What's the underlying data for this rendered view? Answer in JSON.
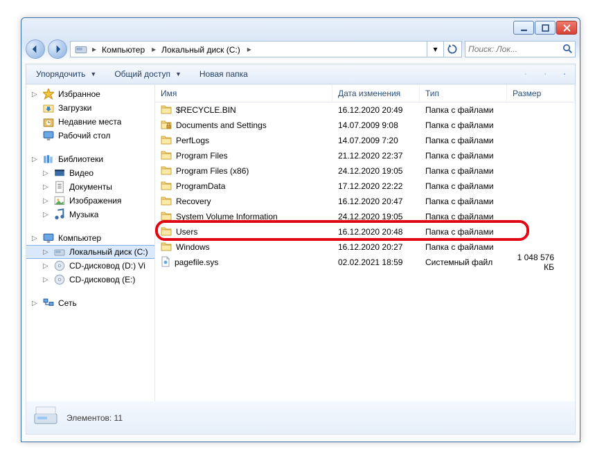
{
  "window": {
    "breadcrumb": {
      "root": "Компьютер",
      "path": "Локальный диск (C:)"
    },
    "search_placeholder": "Поиск: Лок...",
    "toolbar": {
      "organize": "Упорядочить",
      "share": "Общий доступ",
      "newfolder": "Новая папка"
    },
    "sidebar": {
      "favorites": {
        "label": "Избранное",
        "items": [
          "Загрузки",
          "Недавние места",
          "Рабочий стол"
        ]
      },
      "libraries": {
        "label": "Библиотеки",
        "items": [
          "Видео",
          "Документы",
          "Изображения",
          "Музыка"
        ]
      },
      "computer": {
        "label": "Компьютер",
        "items": [
          "Локальный диск (C:)",
          "CD-дисковод (D:) Vi",
          "CD-дисковод (E:)"
        ]
      },
      "network": {
        "label": "Сеть"
      }
    },
    "columns": {
      "name": "Имя",
      "date": "Дата изменения",
      "type": "Тип",
      "size": "Размер"
    },
    "rows": [
      {
        "name": "$RECYCLE.BIN",
        "date": "16.12.2020 20:49",
        "type": "Папка с файлами",
        "size": "",
        "icon": "folder"
      },
      {
        "name": "Documents and Settings",
        "date": "14.07.2009 9:08",
        "type": "Папка с файлами",
        "size": "",
        "icon": "folder-lock"
      },
      {
        "name": "PerfLogs",
        "date": "14.07.2009 7:20",
        "type": "Папка с файлами",
        "size": "",
        "icon": "folder"
      },
      {
        "name": "Program Files",
        "date": "21.12.2020 22:37",
        "type": "Папка с файлами",
        "size": "",
        "icon": "folder"
      },
      {
        "name": "Program Files (x86)",
        "date": "24.12.2020 19:05",
        "type": "Папка с файлами",
        "size": "",
        "icon": "folder"
      },
      {
        "name": "ProgramData",
        "date": "17.12.2020 22:22",
        "type": "Папка с файлами",
        "size": "",
        "icon": "folder"
      },
      {
        "name": "Recovery",
        "date": "16.12.2020 20:47",
        "type": "Папка с файлами",
        "size": "",
        "icon": "folder"
      },
      {
        "name": "System Volume Information",
        "date": "24.12.2020 19:05",
        "type": "Папка с файлами",
        "size": "",
        "icon": "folder"
      },
      {
        "name": "Users",
        "date": "16.12.2020 20:48",
        "type": "Папка с файлами",
        "size": "",
        "icon": "folder",
        "highlighted": true
      },
      {
        "name": "Windows",
        "date": "16.12.2020 20:27",
        "type": "Папка с файлами",
        "size": "",
        "icon": "folder"
      },
      {
        "name": "pagefile.sys",
        "date": "02.02.2021 18:59",
        "type": "Системный файл",
        "size": "1 048 576 КБ",
        "icon": "file"
      }
    ],
    "statusbar": "Элементов: 11"
  }
}
